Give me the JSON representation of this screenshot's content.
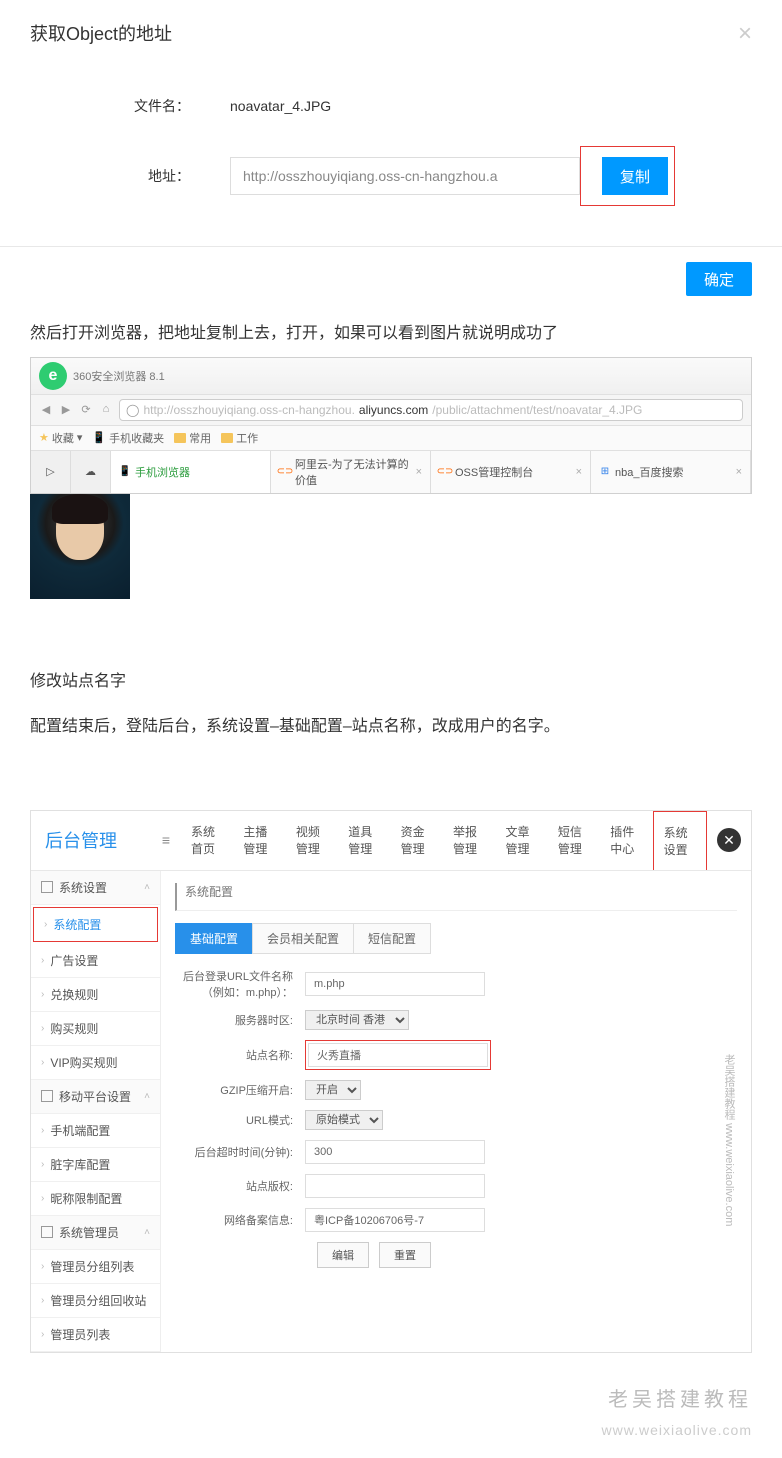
{
  "modal": {
    "title": "获取Object的地址",
    "close": "×",
    "filename_label": "文件名：",
    "filename_value": "noavatar_4.JPG",
    "addr_label": "地址：",
    "url_value": "http://osszhouyiqiang.oss-cn-hangzhou.a",
    "copy_btn": "复制",
    "confirm_btn": "确定"
  },
  "doc_line1": "然后打开浏览器，把地址复制上去，打开，如果可以看到图片就说明成功了",
  "browser": {
    "product": "360安全浏览器 8.1",
    "url_pre": "http://osszhouyiqiang.oss-cn-hangzhou.",
    "url_host": "aliyuncs.com",
    "url_post": "/public/attachment/test/noavatar_4.JPG",
    "fav_label": "收藏",
    "bk1": "手机收藏夹",
    "bk2": "常用",
    "bk3": "工作",
    "tab1": "手机浏览器",
    "tab2": "阿里云-为了无法计算的价值",
    "tab3": "OSS管理控制台",
    "tab4": "nba_百度搜索"
  },
  "doc_heading2": "修改站点名字",
  "doc_line2": "配置结束后，登陆后台，系统设置–基础配置–站点名称，改成用户的名字。",
  "admin": {
    "logo": "后台管理",
    "nav": [
      "系统首页",
      "主播管理",
      "视频管理",
      "道具管理",
      "资金管理",
      "举报管理",
      "文章管理",
      "短信管理",
      "插件中心",
      "系统设置"
    ],
    "sidebar": {
      "g1": "系统设置",
      "i1": "系统配置",
      "i2": "广告设置",
      "i3": "兑换规则",
      "i4": "购买规则",
      "i5": "VIP购买规则",
      "g2": "移动平台设置",
      "i6": "手机端配置",
      "i7": "脏字库配置",
      "i8": "昵称限制配置",
      "g3": "系统管理员",
      "i9": "管理员分组列表",
      "i10": "管理员分组回收站",
      "i11": "管理员列表"
    },
    "breadcrumb": "系统配置",
    "subtabs": [
      "基础配置",
      "会员相关配置",
      "短信配置"
    ],
    "rows": {
      "r1_label": "后台登录URL文件名称（例如：m.php）：",
      "r1_val": "m.php",
      "r2_label": "服务器时区:",
      "r2_val": "北京时间 香港",
      "r3_label": "站点名称:",
      "r3_val": "火秀直播",
      "r4_label": "GZIP压缩开启:",
      "r4_val": "开启",
      "r5_label": "URL模式:",
      "r5_val": "原始模式",
      "r6_label": "后台超时时间(分钟):",
      "r6_val": "300",
      "r7_label": "站点版权:",
      "r8_label": "网络备案信息:",
      "r8_val": "粤ICP备10206706号-7",
      "btn_edit": "编辑",
      "btn_reset": "重置"
    }
  },
  "watermark_v": "www.weixiaolive.com",
  "watermark_cn": "老吴搭建教程",
  "footer_cn": "老吴搭建教程",
  "footer_en": "www.weixiaolive.com"
}
